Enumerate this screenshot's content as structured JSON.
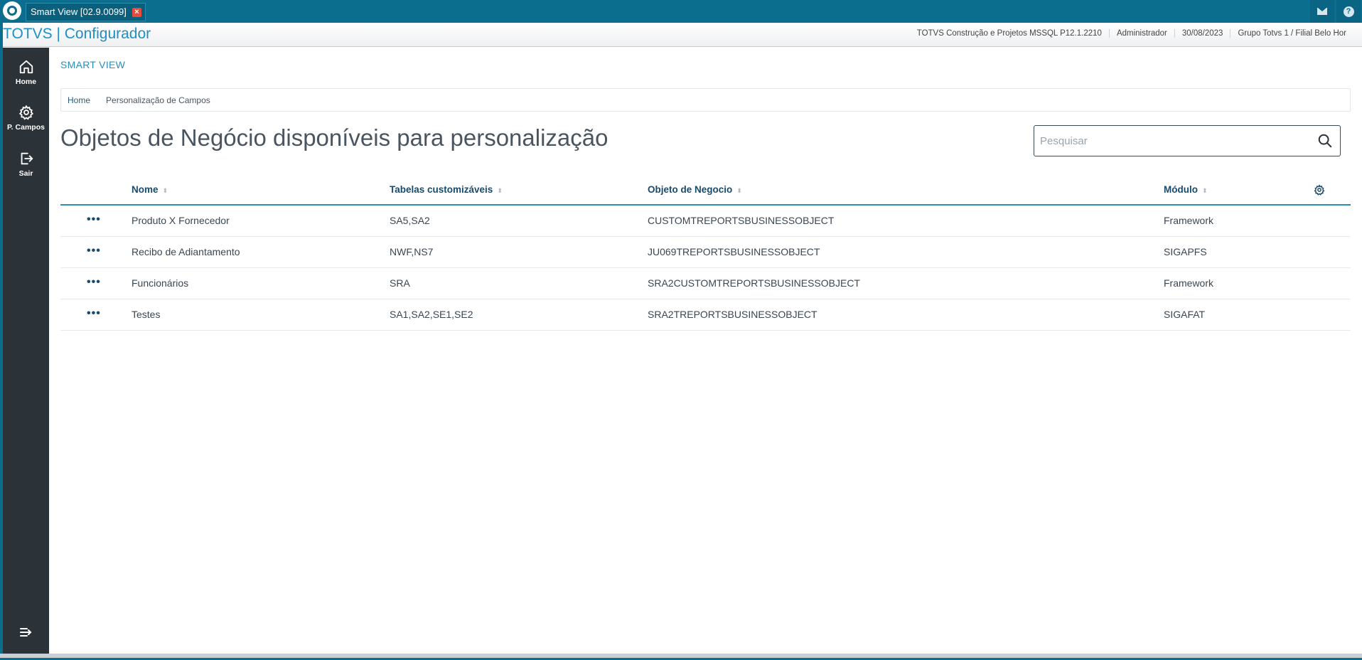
{
  "window": {
    "tab_title": "Smart View [02.9.0099]",
    "close_glyph": "×"
  },
  "header": {
    "app_title": "TOTVS | Configurador",
    "info": [
      "TOTVS Construção e Projetos MSSQL P12.1.2210",
      "Administrador",
      "30/08/2023",
      "Grupo Totvs 1 / Filial Belo Hor"
    ]
  },
  "sidebar": {
    "items": [
      {
        "label": "Home",
        "icon": "home-icon"
      },
      {
        "label": "P. Campos",
        "icon": "gear-icon"
      },
      {
        "label": "Sair",
        "icon": "logout-icon"
      }
    ],
    "collapse_icon": "collapse-menu-icon"
  },
  "main": {
    "section_label": "SMART VIEW",
    "breadcrumb": [
      "Home",
      "Personalização de Campos"
    ],
    "page_title": "Objetos de Negócio disponíveis para personalização",
    "search": {
      "placeholder": "Pesquisar",
      "value": ""
    },
    "table": {
      "columns": [
        "Nome",
        "Tabelas customizáveis",
        "Objeto de Negocio",
        "Módulo"
      ],
      "sort_glyph": "⬍",
      "actions_glyph": "•••",
      "rows": [
        {
          "nome": "Produto X Fornecedor",
          "tabelas": "SA5,SA2",
          "objeto": "CUSTOMTREPORTSBUSINESSOBJECT",
          "modulo": "Framework"
        },
        {
          "nome": "Recibo de Adiantamento",
          "tabelas": "NWF,NS7",
          "objeto": "JU069TREPORTSBUSINESSOBJECT",
          "modulo": "SIGAPFS"
        },
        {
          "nome": "Funcionários",
          "tabelas": "SRA",
          "objeto": "SRA2CUSTOMTREPORTSBUSINESSOBJECT",
          "modulo": "Framework"
        },
        {
          "nome": "Testes",
          "tabelas": "SA1,SA2,SE1,SE2",
          "objeto": "SRA2TREPORTSBUSINESSOBJECT",
          "modulo": "SIGAFAT"
        }
      ]
    }
  },
  "colors": {
    "titlebar": "#0b6e8f",
    "accent": "#2a8fb6",
    "rail": "#2b3338",
    "header_text": "#1a4a6b"
  }
}
